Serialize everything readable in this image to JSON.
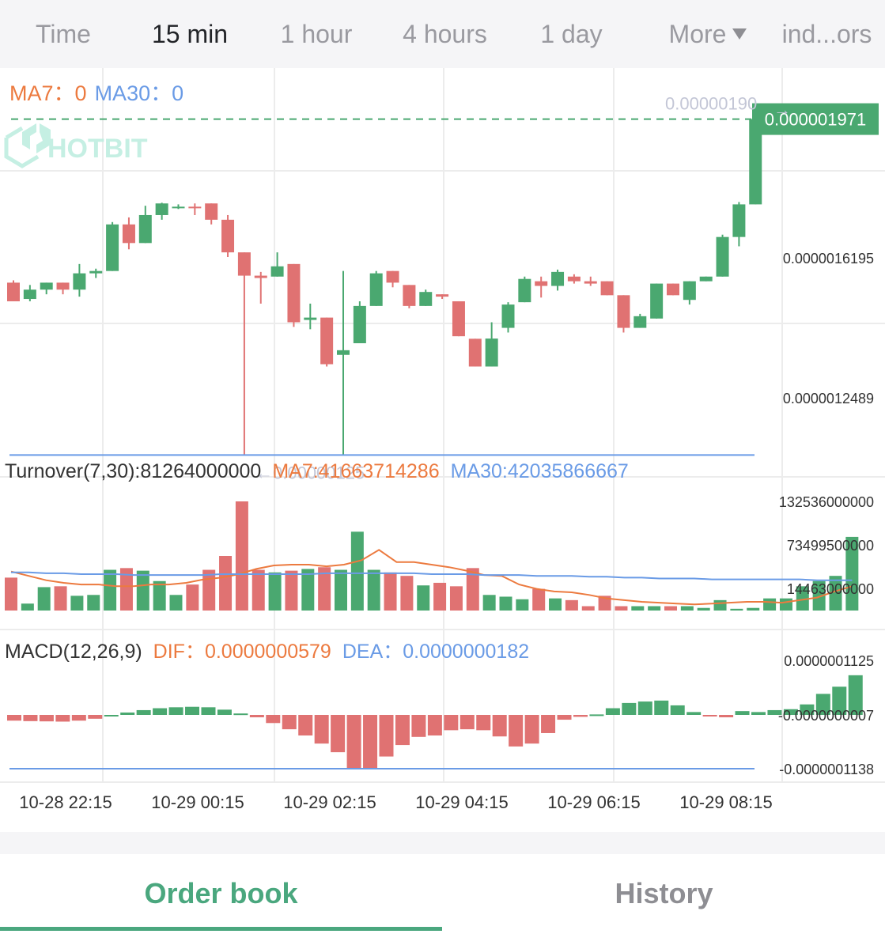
{
  "tabs": [
    {
      "label": "Time"
    },
    {
      "label": "15 min",
      "active": true
    },
    {
      "label": "1 hour"
    },
    {
      "label": "4 hours"
    },
    {
      "label": "1 day"
    },
    {
      "label": "More"
    },
    {
      "label": "ind...ors"
    }
  ],
  "colors": {
    "up": "#4aa870",
    "down": "#e07272",
    "ma7": "#ec7a3f",
    "ma30": "#6a9be6",
    "grid": "#ececec",
    "axis_text": "#333333",
    "annotation": "#c3c6d6",
    "watermark": "#bfeee0"
  },
  "watermark": {
    "text": "HOTBIT"
  },
  "chart_data": [
    {
      "name": "price",
      "type": "candlestick",
      "interval": "15 min",
      "legend": {
        "ma7": "MA7：",
        "ma7_value": "0",
        "ma30": "MA30：",
        "ma30_value": "0"
      },
      "ylim": [
        1.0963e-06,
        2.0806e-06
      ],
      "y_ticks": [
        "0.0000016195",
        "0.0000012489"
      ],
      "x_ticks": [
        "10-28 22:15",
        "10-29 00:15",
        "10-29 02:15",
        "10-29 04:15",
        "10-29 06:15",
        "10-29 08:15"
      ],
      "current_price": "0.000001971",
      "max_label": "0.00000190",
      "min_label": "←0.00000125",
      "min_value": 1.25e-06,
      "candles": [
        {
          "o": 1.62e-06,
          "h": 1.625e-06,
          "l": 1.58e-06,
          "c": 1.58e-06
        },
        {
          "o": 1.585e-06,
          "h": 1.615e-06,
          "l": 1.58e-06,
          "c": 1.605e-06
        },
        {
          "o": 1.605e-06,
          "h": 1.62e-06,
          "l": 1.595e-06,
          "c": 1.62e-06
        },
        {
          "o": 1.62e-06,
          "h": 1.62e-06,
          "l": 1.595e-06,
          "c": 1.605e-06
        },
        {
          "o": 1.605e-06,
          "h": 1.66e-06,
          "l": 1.59e-06,
          "c": 1.64e-06
        },
        {
          "o": 1.64e-06,
          "h": 1.65e-06,
          "l": 1.63e-06,
          "c": 1.645e-06
        },
        {
          "o": 1.645e-06,
          "h": 1.75e-06,
          "l": 1.645e-06,
          "c": 1.745e-06
        },
        {
          "o": 1.745e-06,
          "h": 1.76e-06,
          "l": 1.6915e-06,
          "c": 1.705e-06
        },
        {
          "o": 1.705e-06,
          "h": 1.785e-06,
          "l": 1.705e-06,
          "c": 1.765e-06
        },
        {
          "o": 1.765e-06,
          "h": 1.7915e-06,
          "l": 1.755e-06,
          "c": 1.79e-06
        },
        {
          "o": 1.783e-06,
          "h": 1.788e-06,
          "l": 1.778e-06,
          "c": 1.783e-06
        },
        {
          "o": 1.783e-06,
          "h": 1.79e-06,
          "l": 1.765e-06,
          "c": 1.78e-06
        },
        {
          "o": 1.79e-06,
          "h": 1.79e-06,
          "l": 1.745e-06,
          "c": 1.755e-06
        },
        {
          "o": 1.755e-06,
          "h": 1.765e-06,
          "l": 1.675e-06,
          "c": 1.685e-06
        },
        {
          "o": 1.685e-06,
          "h": 1.685e-06,
          "l": 1.25e-06,
          "c": 1.635e-06
        },
        {
          "o": 1.635e-06,
          "h": 1.643e-06,
          "l": 1.575e-06,
          "c": 1.63e-06
        },
        {
          "o": 1.633e-06,
          "h": 1.685e-06,
          "l": 1.633e-06,
          "c": 1.655e-06
        },
        {
          "o": 1.66e-06,
          "h": 1.66e-06,
          "l": 1.525e-06,
          "c": 1.535e-06
        },
        {
          "o": 1.54e-06,
          "h": 1.575e-06,
          "l": 1.52e-06,
          "c": 1.545e-06
        },
        {
          "o": 1.545e-06,
          "h": 1.545e-06,
          "l": 1.44e-06,
          "c": 1.445e-06
        },
        {
          "o": 1.465e-06,
          "h": 1.645e-06,
          "l": 1.25e-06,
          "c": 1.475e-06
        },
        {
          "o": 1.49e-06,
          "h": 1.58e-06,
          "l": 1.49e-06,
          "c": 1.57e-06
        },
        {
          "o": 1.57e-06,
          "h": 1.645e-06,
          "l": 1.57e-06,
          "c": 1.64e-06
        },
        {
          "o": 1.645e-06,
          "h": 1.645e-06,
          "l": 1.61e-06,
          "c": 1.62e-06
        },
        {
          "o": 1.615e-06,
          "h": 1.615e-06,
          "l": 1.565e-06,
          "c": 1.57e-06
        },
        {
          "o": 1.57e-06,
          "h": 1.605e-06,
          "l": 1.57e-06,
          "c": 1.6e-06
        },
        {
          "o": 1.595e-06,
          "h": 1.595e-06,
          "l": 1.585e-06,
          "c": 1.59e-06
        },
        {
          "o": 1.58e-06,
          "h": 1.58e-06,
          "l": 1.505e-06,
          "c": 1.505e-06
        },
        {
          "o": 1.4996e-06,
          "h": 1.4996e-06,
          "l": 1.44e-06,
          "c": 1.44e-06
        },
        {
          "o": 1.44e-06,
          "h": 1.535e-06,
          "l": 1.44e-06,
          "c": 1.5e-06
        },
        {
          "o": 1.523e-06,
          "h": 1.578e-06,
          "l": 1.513e-06,
          "c": 1.573e-06
        },
        {
          "o": 1.578e-06,
          "h": 1.633e-06,
          "l": 1.578e-06,
          "c": 1.628e-06
        },
        {
          "o": 1.623e-06,
          "h": 1.633e-06,
          "l": 1.588e-06,
          "c": 1.613e-06
        },
        {
          "o": 1.613e-06,
          "h": 1.648e-06,
          "l": 1.603e-06,
          "c": 1.643e-06
        },
        {
          "o": 1.633e-06,
          "h": 1.638e-06,
          "l": 1.618e-06,
          "c": 1.623e-06
        },
        {
          "o": 1.623e-06,
          "h": 1.633e-06,
          "l": 1.613e-06,
          "c": 1.618e-06
        },
        {
          "o": 1.623e-06,
          "h": 1.623e-06,
          "l": 1.593e-06,
          "c": 1.593e-06
        },
        {
          "o": 1.593e-06,
          "h": 1.593e-06,
          "l": 1.513e-06,
          "c": 1.523e-06
        },
        {
          "o": 1.523e-06,
          "h": 1.553e-06,
          "l": 1.523e-06,
          "c": 1.548e-06
        },
        {
          "o": 1.543e-06,
          "h": 1.618e-06,
          "l": 1.543e-06,
          "c": 1.618e-06
        },
        {
          "o": 1.618e-06,
          "h": 1.618e-06,
          "l": 1.593e-06,
          "c": 1.593e-06
        },
        {
          "o": 1.583e-06,
          "h": 1.623e-06,
          "l": 1.573e-06,
          "c": 1.623e-06
        },
        {
          "o": 1.623e-06,
          "h": 1.633e-06,
          "l": 1.623e-06,
          "c": 1.633e-06
        },
        {
          "o": 1.633e-06,
          "h": 1.723e-06,
          "l": 1.633e-06,
          "c": 1.718e-06
        },
        {
          "o": 1.718e-06,
          "h": 1.793e-06,
          "l": 1.698e-06,
          "c": 1.788e-06
        },
        {
          "o": 1.788e-06,
          "h": 1.971e-06,
          "l": 1.788e-06,
          "c": 1.971e-06
        }
      ]
    },
    {
      "name": "turnover",
      "type": "bar",
      "legend": {
        "main": "Turnover(7,30):81264000000",
        "ma7": "MA7:41663714286",
        "ma30": "MA30:42035866667"
      },
      "y_ticks": [
        "132536000000",
        "73499500000",
        "14463000000"
      ],
      "values": [
        38,
        8,
        27,
        28,
        17,
        18,
        47,
        49,
        46,
        34,
        18,
        30,
        47,
        63,
        126,
        47,
        44,
        46,
        48,
        50,
        47,
        91,
        47,
        44,
        40,
        29,
        32,
        28,
        49,
        18,
        16,
        13,
        25,
        14,
        12,
        5,
        17,
        5,
        5,
        5,
        5,
        5,
        3,
        12,
        2,
        3,
        14,
        14,
        28,
        34,
        40,
        85
      ],
      "ma7": [
        45,
        40,
        35,
        32,
        30,
        30,
        28,
        28,
        30,
        30,
        32,
        36,
        38,
        42,
        48,
        52,
        53,
        53,
        51,
        53,
        58,
        70,
        56,
        56,
        53,
        50,
        46,
        41,
        40,
        30,
        25,
        22,
        21,
        18,
        14,
        12,
        10,
        9,
        8,
        7,
        8,
        9,
        10,
        10,
        9,
        12,
        15,
        22,
        28
      ],
      "ma30": [
        44,
        44,
        43,
        43,
        42,
        42,
        42,
        41,
        41,
        41,
        41,
        41,
        42,
        42,
        42,
        42,
        42,
        42,
        43,
        43,
        43,
        43,
        43,
        43,
        42,
        42,
        42,
        41,
        41,
        41,
        40,
        40,
        40,
        39,
        39,
        38,
        38,
        37,
        37,
        37,
        36,
        36,
        36,
        36,
        36,
        36,
        35,
        35,
        35
      ]
    },
    {
      "name": "macd",
      "type": "bar",
      "legend": {
        "main": "MACD(12,26,9)",
        "dif": "DIF：",
        "dif_value": "0.0000000579",
        "dea": "DEA：",
        "dea_value": "0.0000000182"
      },
      "y_ticks": [
        "0.0000001125",
        "-0.0000000007",
        "-0.0000001138"
      ],
      "ylim": [
        -1.138e-07,
        1.125e-07
      ],
      "values": [
        -1.2e-08,
        -1.3e-08,
        -1.35e-08,
        -1.4e-08,
        -1.2e-08,
        -8e-09,
        0,
        5e-09,
        1e-08,
        1.4e-08,
        1.6e-08,
        1.7e-08,
        1.6e-08,
        1.1e-08,
        3e-09,
        -5e-09,
        -1.7e-08,
        -3e-08,
        -4.3e-08,
        -6e-08,
        -7.8e-08,
        -1.12e-07,
        -1.12e-07,
        -8.7e-08,
        -6.3e-08,
        -4.6e-08,
        -4.3e-08,
        -3.2e-08,
        -3e-08,
        -3.2e-08,
        -4.5e-08,
        -6.6e-08,
        -6e-08,
        -3.8e-08,
        -1e-08,
        -4e-09,
        1e-09,
        1.4e-08,
        2.5e-08,
        2.8e-08,
        3e-08,
        2e-08,
        6e-09,
        -3e-09,
        -5e-09,
        8e-09,
        6e-09,
        1e-08,
        1.2e-08,
        2.2e-08,
        4.4e-08,
        5.9e-08,
        8.3e-08
      ]
    }
  ],
  "bottom_tabs": [
    {
      "label": "Order book",
      "active": true
    },
    {
      "label": "History"
    }
  ]
}
